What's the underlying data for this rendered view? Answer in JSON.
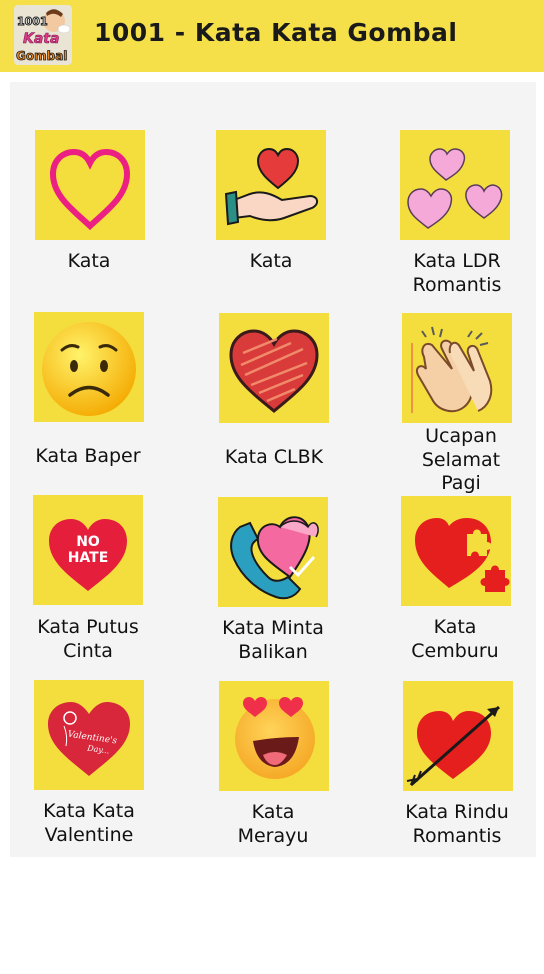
{
  "app": {
    "title": "1001 - Kata Kata Gombal",
    "logo": {
      "line1": "1001",
      "line2": "Kata",
      "line3": "Gombal"
    }
  },
  "categories": [
    {
      "label": "Kata",
      "icon": "heart-outline-icon"
    },
    {
      "label": "Kata",
      "icon": "hand-heart-icon"
    },
    {
      "label": "Kata LDR\nRomantis",
      "icon": "three-hearts-icon"
    },
    {
      "label": "Kata Baper",
      "icon": "sad-face-icon"
    },
    {
      "label": "Kata CLBK",
      "icon": "scribble-heart-icon"
    },
    {
      "label": "Ucapan\nSelamat\nPagi",
      "icon": "clapping-hands-icon"
    },
    {
      "label": "Kata Putus\nCinta",
      "icon": "no-hate-heart-icon",
      "icon_text": "NO\nHATE"
    },
    {
      "label": "Kata Minta\nBalikan",
      "icon": "phone-heart-icon"
    },
    {
      "label": "Kata\nCemburu",
      "icon": "puzzle-heart-icon"
    },
    {
      "label": "Kata Kata\nValentine",
      "icon": "valentine-heart-icon",
      "icon_text": "Valentine's Day"
    },
    {
      "label": "Kata\nMerayu",
      "icon": "heart-eyes-emoji-icon"
    },
    {
      "label": "Kata Rindu\nRomantis",
      "icon": "arrow-heart-icon"
    }
  ],
  "colors": {
    "appbar": "#f5e04a",
    "tile": "#f4de3e",
    "panel": "#f4f4f4"
  }
}
